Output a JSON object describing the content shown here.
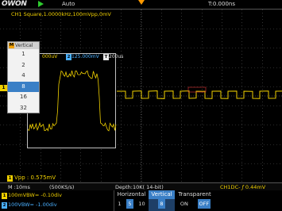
{
  "header": {
    "logo": "OWON",
    "run_state": "Auto",
    "time_offset": "T:0.000ns"
  },
  "signal": {
    "description": "CH1 Square,1.0000kHz,100mVpp,0mV",
    "ch1_marker": "1"
  },
  "vertical_menu": {
    "tag": "M",
    "title": "Vertical",
    "items": [
      "1",
      "2",
      "4",
      "8",
      "16",
      "32"
    ],
    "selected_index": 3
  },
  "zoom_header": {
    "ch1_tag": "1",
    "ch1_scale": "000uV",
    "ch2_tag": "2",
    "ch2_scale": "125.000mV",
    "time_tag": "T",
    "time_scale": "200us"
  },
  "measurement": {
    "tag": "1",
    "label": "Vpp : 0.575mV"
  },
  "info": {
    "timebase": "M :10ms",
    "sample_rate": "(500KS/s)",
    "depth": "Depth:10K( 14-bit)",
    "trigger": "CH1DC-",
    "trigger_level": "0.44mV"
  },
  "channels": {
    "ch1_tag": "1",
    "ch1_scale": "100mVBW= -0.10div",
    "ch2_tag": "2",
    "ch2_scale": "100VBW= -1.00div"
  },
  "softkeys": {
    "horizontal": {
      "label": "Horizontal",
      "options": [
        "1",
        "5",
        "10"
      ],
      "selected": 1
    },
    "vertical": {
      "label": "Vertical",
      "options": [
        "8"
      ],
      "selected": 0
    },
    "transparent": {
      "label": "Transparent",
      "options": [
        "ON",
        "OFF"
      ],
      "selected": 1
    }
  },
  "colors": {
    "ch1": "#f0d000",
    "ch2": "#4ab0ff",
    "selection": "#3a7fc6",
    "trigger_marker": "#ff9a00"
  }
}
